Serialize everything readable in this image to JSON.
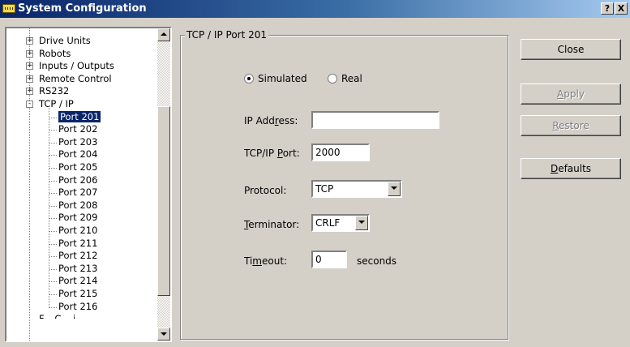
{
  "window": {
    "title": "System Configuration",
    "help_label": "?",
    "close_label": "X"
  },
  "tree": {
    "top_items": [
      {
        "label": "Drive Units",
        "expander": "+"
      },
      {
        "label": "Robots",
        "expander": "+"
      },
      {
        "label": "Inputs / Outputs",
        "expander": "+"
      },
      {
        "label": "Remote Control",
        "expander": "+"
      },
      {
        "label": "RS232",
        "expander": "+"
      },
      {
        "label": "TCP / IP",
        "expander": "-"
      }
    ],
    "ports": [
      "Port 201",
      "Port 202",
      "Port 203",
      "Port 204",
      "Port 205",
      "Port 206",
      "Port 207",
      "Port 208",
      "Port 209",
      "Port 210",
      "Port 211",
      "Port 212",
      "Port 213",
      "Port 214",
      "Port 215",
      "Port 216"
    ],
    "selected": "Port 201",
    "partial_label": "F... C... i..."
  },
  "panel": {
    "group_title": "TCP / IP Port 201",
    "mode": {
      "simulated_label": "Simulated",
      "real_label": "Real",
      "selected": "Simulated"
    },
    "ip_address": {
      "label_pre": "IP Add",
      "label_u": "r",
      "label_post": "ess:",
      "value": ""
    },
    "tcp_port": {
      "label_pre": "TCP/IP ",
      "label_u": "P",
      "label_post": "ort:",
      "value": "2000"
    },
    "protocol": {
      "label": "Protocol:",
      "value": "TCP"
    },
    "terminator": {
      "label_u": "T",
      "label_post": "erminator:",
      "value": "CRLF"
    },
    "timeout": {
      "label_pre": "Ti",
      "label_u": "m",
      "label_post": "eout:",
      "value": "0",
      "unit": "seconds"
    }
  },
  "buttons": {
    "close": "Close",
    "apply_u": "A",
    "apply_rest": "pply",
    "restore_u": "R",
    "restore_rest": "estore",
    "defaults_u": "D",
    "defaults_rest": "efaults"
  }
}
